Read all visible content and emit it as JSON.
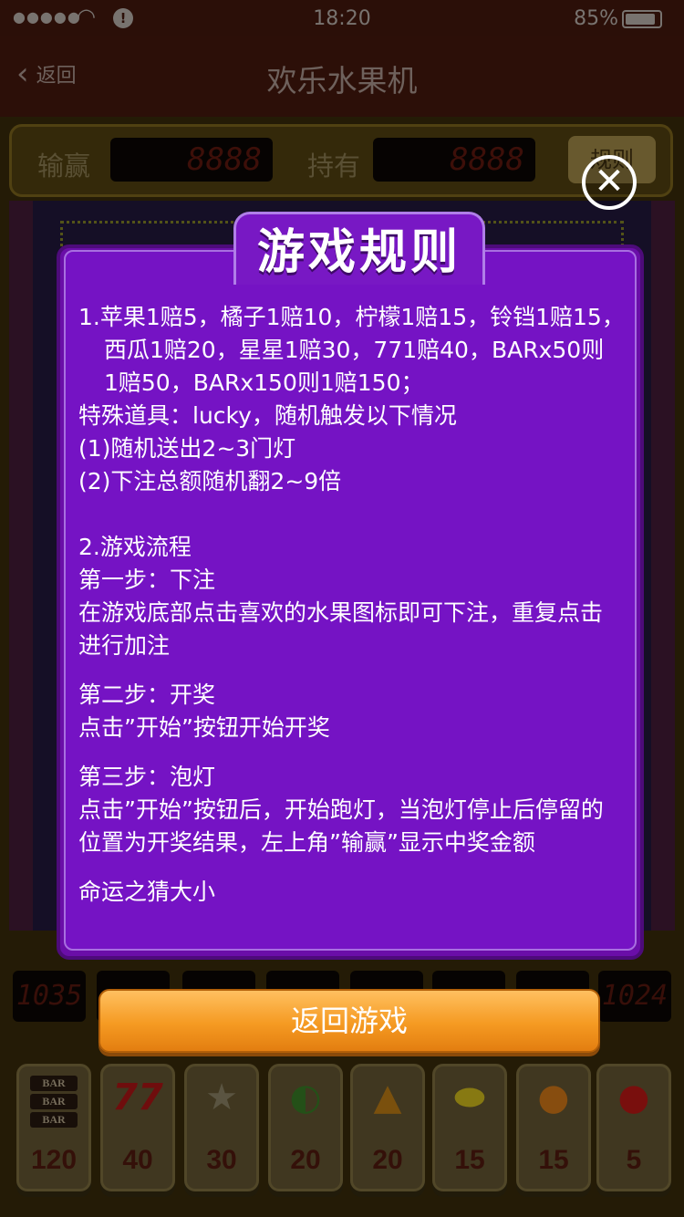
{
  "status_bar": {
    "time": "18:20",
    "battery": "85%"
  },
  "nav": {
    "back_label": "返回",
    "title": "欢乐水果机"
  },
  "score": {
    "win_label": "输赢",
    "win_value": "8888",
    "hold_label": "持有",
    "hold_value": "8888",
    "rule_button": "规则"
  },
  "led_row": [
    "1035",
    "",
    "",
    "",
    "",
    "",
    "",
    "1024"
  ],
  "bets": [
    {
      "symbol": "bar",
      "value": "120"
    },
    {
      "symbol": "seven",
      "value": "40"
    },
    {
      "symbol": "star",
      "value": "30"
    },
    {
      "symbol": "watermelon",
      "value": "20"
    },
    {
      "symbol": "bell",
      "value": "20"
    },
    {
      "symbol": "lemon",
      "value": "15"
    },
    {
      "symbol": "orange",
      "value": "15"
    },
    {
      "symbol": "apple",
      "value": "5"
    }
  ],
  "bar_text": "BAR",
  "dialog": {
    "title": "游戏规则",
    "close_icon": "close-icon",
    "rules": {
      "l1": "1.苹果1赔5，橘子1赔10，柠檬1赔15，铃铛1赔15，",
      "l2": "西瓜1赔20，星星1赔30，771赔40，BARx50则",
      "l3": "1赔50，BARx150则1赔150；",
      "l4": "特殊道具：lucky，随机触发以下情况",
      "l5": "(1)随机送出2~3门灯",
      "l6": "(2)下注总额随机翻2~9倍",
      "l7": "2.游戏流程",
      "l8": "第一步：下注",
      "l9": "在游戏底部点击喜欢的水果图标即可下注，重复点击",
      "l10": "进行加注",
      "l11": "第二步：开奖",
      "l12": "点击”开始”按钮开始开奖",
      "l13": "第三步：泡灯",
      "l14": "点击”开始”按钮后，开始跑灯，当泡灯停止后停留的",
      "l15": "位置为开奖结果，左上角”输赢”显示中奖金额",
      "l16": "命运之猜大小"
    },
    "back_button": "返回游戏"
  }
}
